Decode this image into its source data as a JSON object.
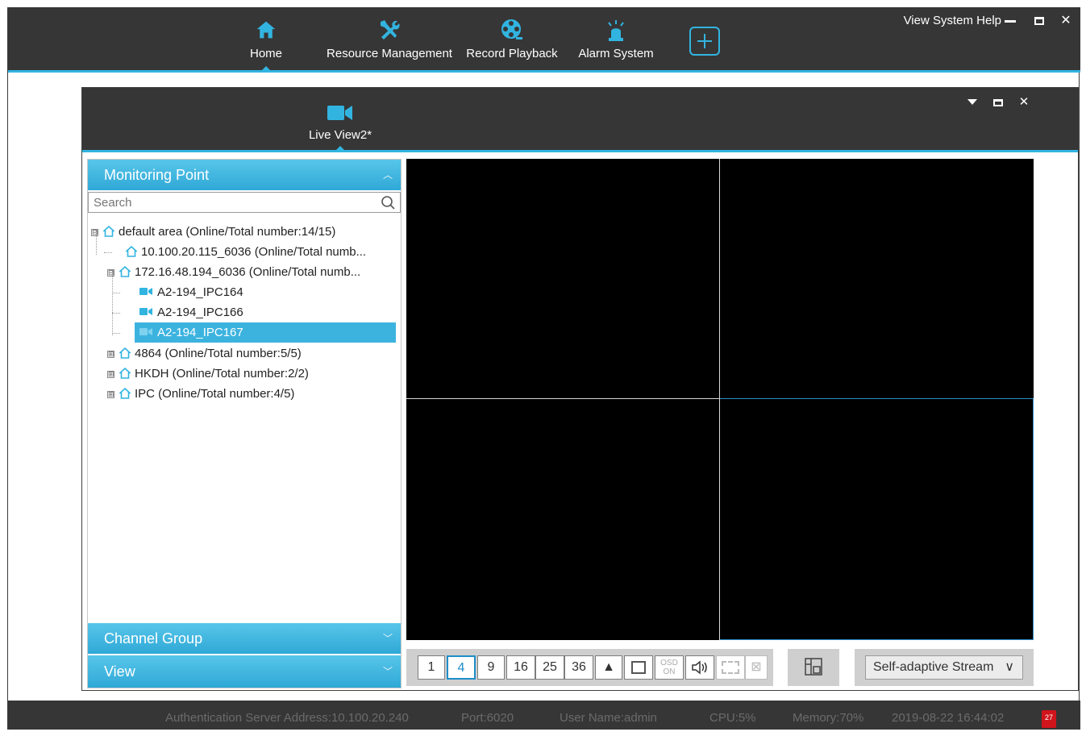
{
  "topbar": {
    "nav": [
      {
        "label": "Home",
        "icon": "home-icon"
      },
      {
        "label": "Resource Management",
        "icon": "tools-icon"
      },
      {
        "label": "Record Playback",
        "icon": "film-reel-icon"
      },
      {
        "label": "Alarm System",
        "icon": "alarm-light-icon"
      }
    ],
    "system_menu": "View System Help",
    "window_controls": [
      "minimize-icon",
      "maximize-icon",
      "close-icon"
    ]
  },
  "inner_window": {
    "tab_label": "Live View2*",
    "controls": [
      "dropdown-icon",
      "maximize-icon",
      "close-icon"
    ]
  },
  "left_panel": {
    "monitoring_point": "Monitoring Point",
    "search_placeholder": "Search",
    "tree": [
      {
        "label": "default area (Online/Total number:14/15)",
        "type": "area",
        "expander": "⊟"
      },
      {
        "label": "10.100.20.115_6036 (Online/Total numb...",
        "type": "area",
        "expander": ""
      },
      {
        "label": "172.16.48.194_6036 (Online/Total numb...",
        "type": "area",
        "expander": "⊟"
      },
      {
        "label": "A2-194_IPC164",
        "type": "camera"
      },
      {
        "label": "A2-194_IPC166",
        "type": "camera"
      },
      {
        "label": "A2-194_IPC167",
        "type": "camera",
        "selected": true
      },
      {
        "label": "4864 (Online/Total number:5/5)",
        "type": "area",
        "expander": "⊞"
      },
      {
        "label": "HKDH (Online/Total number:2/2)",
        "type": "area",
        "expander": "⊞"
      },
      {
        "label": "IPC (Online/Total number:4/5)",
        "type": "area",
        "expander": "⊞"
      }
    ],
    "channel_group": "Channel Group",
    "view": "View"
  },
  "toolbar": {
    "layouts": [
      "1",
      "4",
      "9",
      "16",
      "25",
      "36"
    ],
    "selected_layout": "4",
    "osd": "OSD ON",
    "stream": "Self-adaptive Stream"
  },
  "status": {
    "auth": "Authentication Server  Address:10.100.20.240",
    "port": "Port:6020",
    "user": "User Name:admin",
    "cpu": "CPU:5%",
    "memory": "Memory:70%",
    "datetime": "2019-08-22 16:44:02",
    "alarm_count": "27"
  },
  "colors": {
    "accent": "#32b4e0",
    "bar": "#363636",
    "alarm": "#d0141b"
  }
}
